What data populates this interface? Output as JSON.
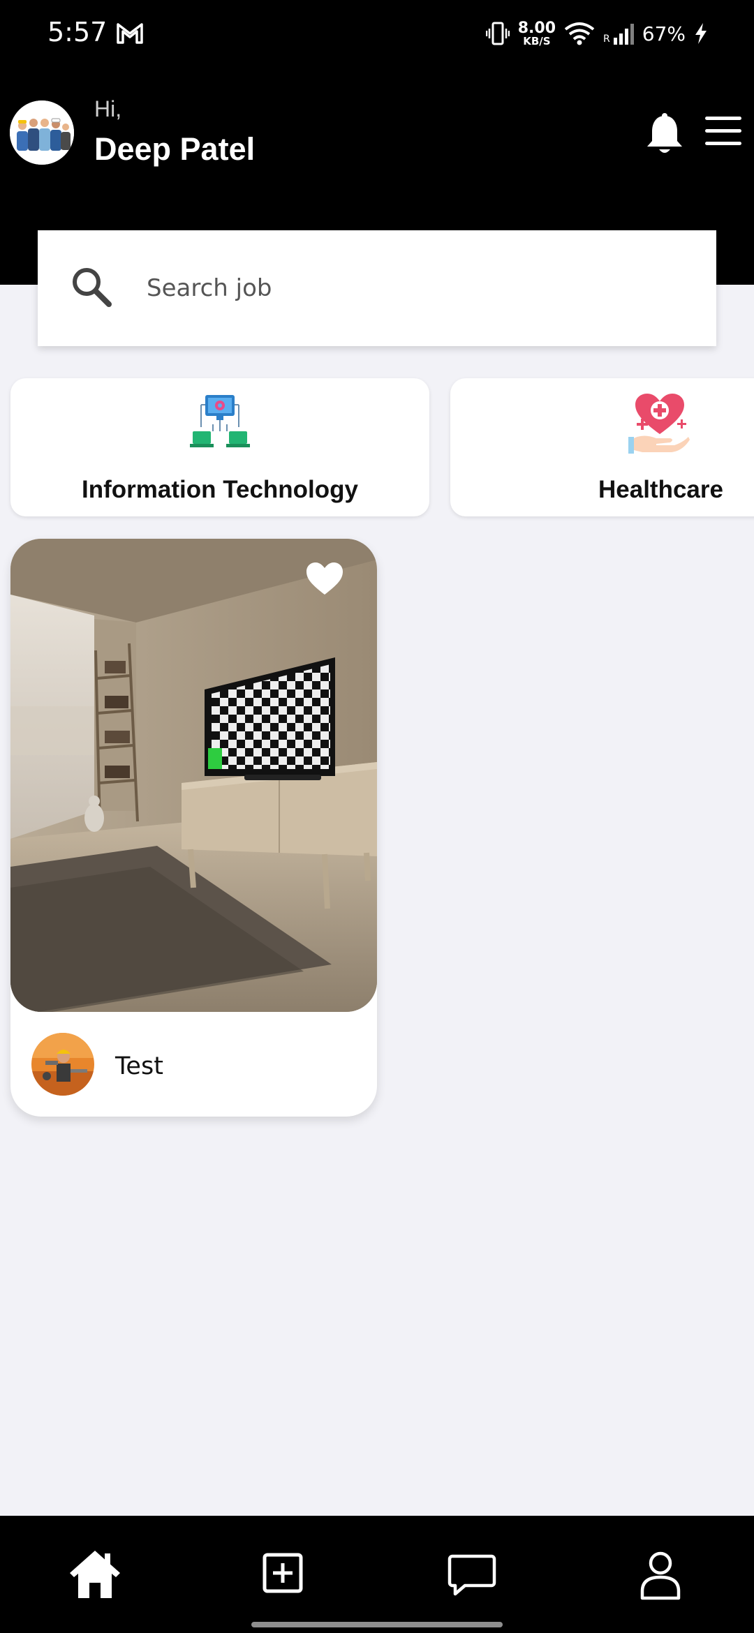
{
  "status_bar": {
    "time": "5:57",
    "speed_value": "8.00",
    "speed_unit": "KB/S",
    "roaming": "R",
    "battery": "67%"
  },
  "header": {
    "greeting": "Hi,",
    "user_name": "Deep Patel"
  },
  "search": {
    "placeholder": "Search job"
  },
  "categories": [
    {
      "label": "Information Technology",
      "icon": "it-network-icon"
    },
    {
      "label": "Healthcare",
      "icon": "healthcare-icon"
    }
  ],
  "jobs": [
    {
      "title": "Test",
      "favorited": true
    }
  ],
  "bottom_nav": [
    {
      "icon": "home-icon",
      "active": true
    },
    {
      "icon": "add-icon",
      "active": false
    },
    {
      "icon": "chat-icon",
      "active": false
    },
    {
      "icon": "profile-icon",
      "active": false
    }
  ],
  "colors": {
    "header_bg": "#000000",
    "page_bg": "#f2f2f7",
    "card_bg": "#ffffff",
    "it_accent": "#22b573",
    "health_accent": "#e94b6a"
  }
}
